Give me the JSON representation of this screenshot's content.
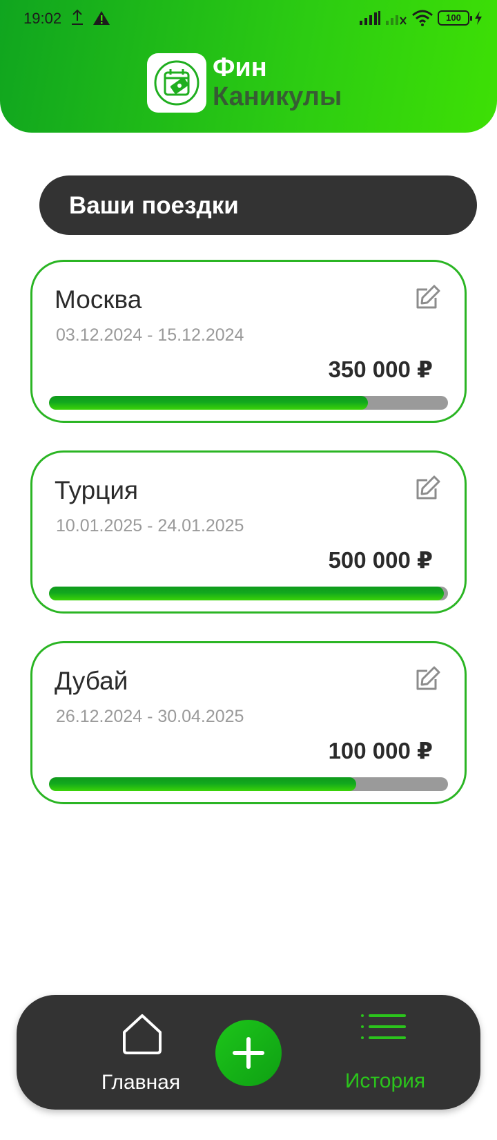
{
  "status_bar": {
    "time": "19:02",
    "battery": "100",
    "icons": [
      "upload-icon",
      "warning-icon",
      "signal-icon",
      "no-signal-icon",
      "wifi-icon",
      "battery-icon",
      "charging-icon"
    ]
  },
  "header": {
    "logo_line1": "Фин",
    "logo_line2": "Каникулы",
    "logo_icon": "calendar-money-icon"
  },
  "section": {
    "title": "Ваши поездки"
  },
  "trips": [
    {
      "name": "Москва",
      "dates": "03.12.2024 - 15.12.2024",
      "amount": "350 000 ₽",
      "progress": 0.8
    },
    {
      "name": "Турция",
      "dates": "10.01.2025 - 24.01.2025",
      "amount": "500 000 ₽",
      "progress": 0.99
    },
    {
      "name": "Дубай",
      "dates": "26.12.2024 - 30.04.2025",
      "amount": "100 000 ₽",
      "progress": 0.77
    }
  ],
  "bottom_nav": {
    "home_label": "Главная",
    "history_label": "История",
    "add_icon": "plus-icon"
  },
  "colors": {
    "accent": "#2bc41c",
    "dark": "#333333",
    "header_start": "#10a51f",
    "header_end": "#3ee005",
    "muted_text": "#9a9a9a"
  }
}
